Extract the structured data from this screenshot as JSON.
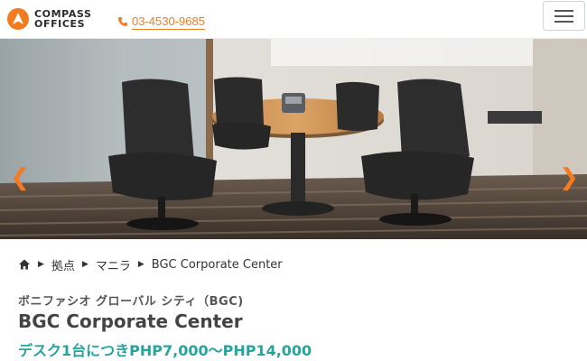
{
  "header": {
    "logo_line1": "COMPASS",
    "logo_line2": "OFFICES",
    "phone": "03-4530-9685",
    "menu_icon": "hamburger-menu-icon"
  },
  "carousel": {
    "prev_icon": "chevron-left-icon",
    "next_icon": "chevron-right-icon",
    "prev_glyph": "❮",
    "next_glyph": "❯",
    "slide_count": 9,
    "active_index": 4
  },
  "breadcrumb": {
    "home_icon": "home-icon",
    "items": [
      "拠点",
      "マニラ",
      "BGC Corporate Center"
    ]
  },
  "property": {
    "subtitle": "ボニファシオ グローバル シティ（BGC)",
    "title": "BGC Corporate Center",
    "price": "デスク1台につきPHP7,000～PHP14,000"
  },
  "colors": {
    "accent": "#f47b20",
    "price": "#25a59c",
    "text": "#444444"
  }
}
